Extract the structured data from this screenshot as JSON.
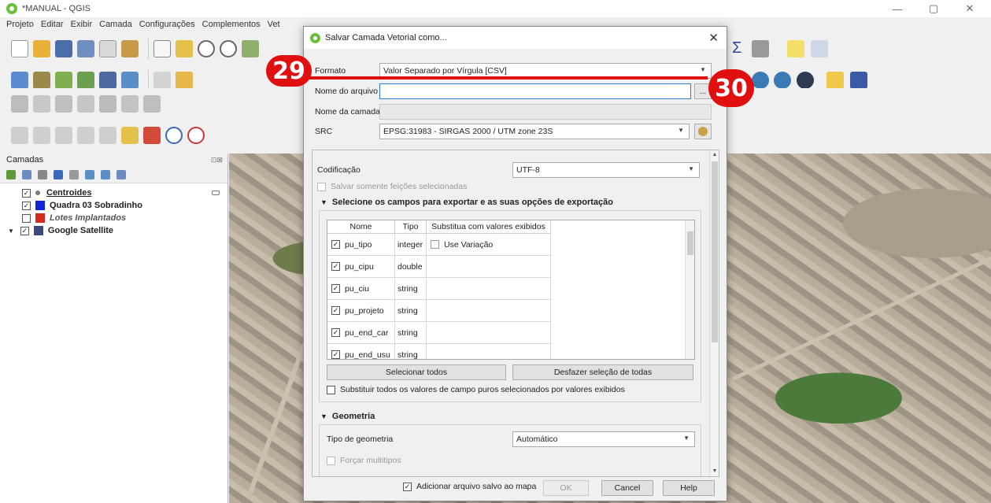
{
  "window": {
    "title": "*MANUAL - QGIS",
    "minimize": "—",
    "maximize": "▢",
    "close": "✕"
  },
  "menu": [
    "Projeto",
    "Editar",
    "Exibir",
    "Camada",
    "Configurações",
    "Complementos",
    "Vet"
  ],
  "layers_panel": {
    "title": "Camadas",
    "items": [
      {
        "label": "Centroides",
        "checked": true,
        "bold": true,
        "underline": true,
        "color": "#7a7a7a"
      },
      {
        "label": "Quadra 03 Sobradinho",
        "checked": true,
        "bold": true,
        "color": "#1326d6"
      },
      {
        "label": "Lotes Implantados",
        "checked": false,
        "italic": true,
        "color": "#d42a1e"
      },
      {
        "label": "Google Satellite",
        "checked": true,
        "bold": true,
        "color": "#3a4a7a"
      }
    ]
  },
  "dialog": {
    "title": "Salvar Camada Vetorial como...",
    "close": "✕",
    "formato_label": "Formato",
    "formato_value": "Valor Separado por Vírgula [CSV]",
    "arquivo_label": "Nome do arquivo",
    "arquivo_value": "",
    "browse": "...",
    "camada_label": "Nome da camada",
    "src_label": "SRC",
    "src_value": "EPSG:31983 - SIRGAS 2000 / UTM zone 23S",
    "codificacao_label": "Codificação",
    "codificacao_value": "UTF-8",
    "somente_label": "Salvar somente feições selecionadas",
    "export_section": "Selecione os campos para exportar e as suas opções de exportação",
    "table": {
      "headers": [
        "Nome",
        "Tipo",
        "Substitua com valores exibidos"
      ],
      "rows": [
        {
          "name": "pu_tipo",
          "type": "integer",
          "option": "Use Variação"
        },
        {
          "name": "pu_cipu",
          "type": "double",
          "option": ""
        },
        {
          "name": "pu_ciu",
          "type": "string",
          "option": ""
        },
        {
          "name": "pu_projeto",
          "type": "string",
          "option": ""
        },
        {
          "name": "pu_end_car",
          "type": "string",
          "option": ""
        },
        {
          "name": "pu_end_usu",
          "type": "string",
          "option": ""
        }
      ]
    },
    "select_all": "Selecionar todos",
    "deselect_all": "Desfazer seleção de todas",
    "replace_label": "Substituir todos os valores de campo puros selecionados por valores exibidos",
    "geometry_section": "Geometria",
    "geom_type_label": "Tipo de geometria",
    "geom_type_value": "Automático",
    "force_multi": "Forçar multitipos",
    "add_to_map": "Adicionar arquivo salvo ao mapa",
    "ok": "OK",
    "cancel": "Cancel",
    "help": "Help"
  },
  "annotations": {
    "step1": "29",
    "step2": "30"
  },
  "colors": {
    "accent_red": "#e01010",
    "focus_blue": "#2b7fd6"
  }
}
